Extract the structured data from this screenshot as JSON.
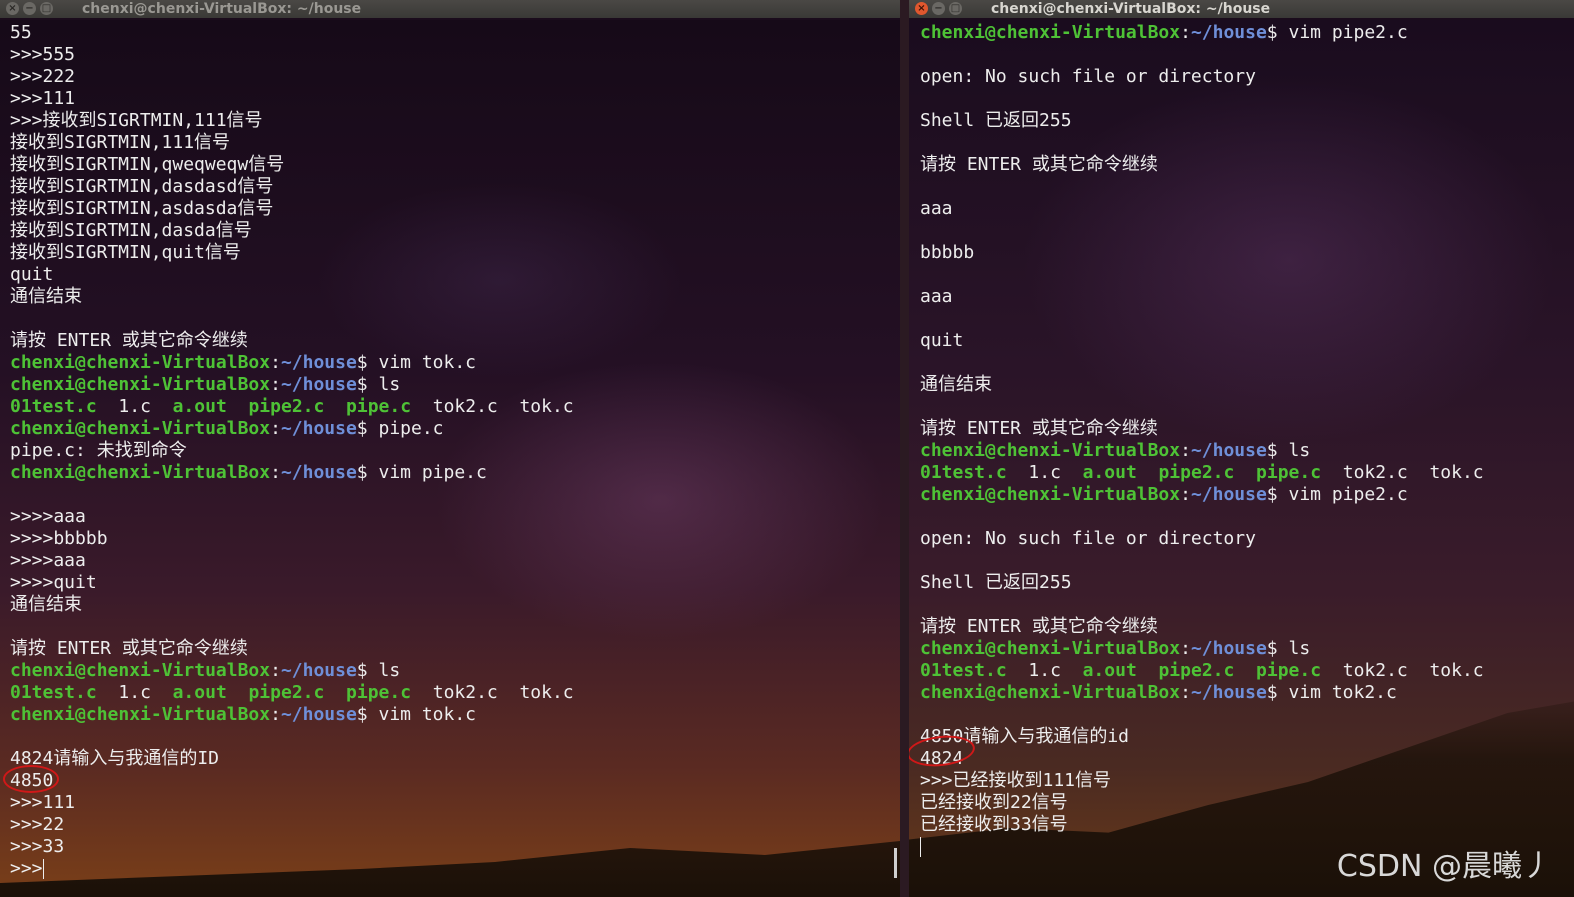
{
  "left_window": {
    "title": "chenxi@chenxi-VirtualBox: ~/house",
    "lines": [
      {
        "t": "55"
      },
      {
        "t": ">>>555"
      },
      {
        "t": ">>>222"
      },
      {
        "t": ">>>111"
      },
      {
        "t": ">>>接收到SIGRTMIN,111信号"
      },
      {
        "t": "接收到SIGRTMIN,111信号"
      },
      {
        "t": "接收到SIGRTMIN,qweqweqw信号"
      },
      {
        "t": "接收到SIGRTMIN,dasdasd信号"
      },
      {
        "t": "接收到SIGRTMIN,asdasda信号"
      },
      {
        "t": "接收到SIGRTMIN,dasda信号"
      },
      {
        "t": "接收到SIGRTMIN,quit信号"
      },
      {
        "t": "quit"
      },
      {
        "t": "通信结束"
      },
      {
        "t": ""
      },
      {
        "t": "请按 ENTER 或其它命令继续"
      },
      {
        "prompt": true,
        "cmd": " vim tok.c"
      },
      {
        "prompt": true,
        "cmd": " ls"
      },
      {
        "files": true
      },
      {
        "prompt": true,
        "cmd": " pipe.c"
      },
      {
        "t": "pipe.c: 未找到命令"
      },
      {
        "prompt": true,
        "cmd": " vim pipe.c"
      },
      {
        "t": ""
      },
      {
        "t": ">>>>aaa"
      },
      {
        "t": ">>>>bbbbb"
      },
      {
        "t": ">>>>aaa"
      },
      {
        "t": ">>>>quit"
      },
      {
        "t": "通信结束"
      },
      {
        "t": ""
      },
      {
        "t": "请按 ENTER 或其它命令继续"
      },
      {
        "prompt": true,
        "cmd": " ls"
      },
      {
        "files": true
      },
      {
        "prompt": true,
        "cmd": " vim tok.c"
      },
      {
        "t": ""
      },
      {
        "t": "4824请输入与我通信的ID"
      },
      {
        "t": "4850"
      },
      {
        "t": ">>>111"
      },
      {
        "t": ">>>22"
      },
      {
        "t": ">>>33"
      },
      {
        "t": ">>>",
        "cursor": true
      }
    ]
  },
  "right_window": {
    "title": "chenxi@chenxi-VirtualBox: ~/house",
    "lines": [
      {
        "prompt": true,
        "cmd": " vim pipe2.c"
      },
      {
        "t": ""
      },
      {
        "t": "open: No such file or directory"
      },
      {
        "t": ""
      },
      {
        "t": "Shell 已返回255"
      },
      {
        "t": ""
      },
      {
        "t": "请按 ENTER 或其它命令继续"
      },
      {
        "t": ""
      },
      {
        "t": "aaa"
      },
      {
        "t": ""
      },
      {
        "t": "bbbbb"
      },
      {
        "t": ""
      },
      {
        "t": "aaa"
      },
      {
        "t": ""
      },
      {
        "t": "quit"
      },
      {
        "t": ""
      },
      {
        "t": "通信结束"
      },
      {
        "t": ""
      },
      {
        "t": "请按 ENTER 或其它命令继续"
      },
      {
        "prompt": true,
        "cmd": " ls"
      },
      {
        "files": true
      },
      {
        "prompt": true,
        "cmd": " vim pipe2.c"
      },
      {
        "t": ""
      },
      {
        "t": "open: No such file or directory"
      },
      {
        "t": ""
      },
      {
        "t": "Shell 已返回255"
      },
      {
        "t": ""
      },
      {
        "t": "请按 ENTER 或其它命令继续"
      },
      {
        "prompt": true,
        "cmd": " ls"
      },
      {
        "files": true
      },
      {
        "prompt": true,
        "cmd": " vim tok2.c"
      },
      {
        "t": ""
      },
      {
        "t": "4850请输入与我通信的id"
      },
      {
        "t": "4824"
      },
      {
        "t": ">>>已经接收到111信号"
      },
      {
        "t": "已经接收到22信号"
      },
      {
        "t": "已经接收到33信号"
      },
      {
        "t": "",
        "cursor": true
      }
    ]
  },
  "prompt": {
    "user_host": "chenxi@chenxi-VirtualBox",
    "colon": ":",
    "path": "~/house",
    "dollar": "$"
  },
  "files": {
    "green": [
      "01test.c",
      "a.out",
      "pipe2.c",
      "pipe.c"
    ],
    "items": [
      {
        "name": "01test.c",
        "exec": true
      },
      {
        "name": "1.c",
        "exec": false
      },
      {
        "name": "a.out",
        "exec": true
      },
      {
        "name": "pipe2.c",
        "exec": true
      },
      {
        "name": "pipe.c",
        "exec": true
      },
      {
        "name": "tok2.c",
        "exec": false
      },
      {
        "name": "tok.c",
        "exec": false
      }
    ]
  },
  "watermark": "CSDN @晨曦丿",
  "colors": {
    "prompt_user": "#4ec236",
    "prompt_path": "#6f8fd8",
    "text": "#ededed",
    "annotation": "#d01818"
  }
}
